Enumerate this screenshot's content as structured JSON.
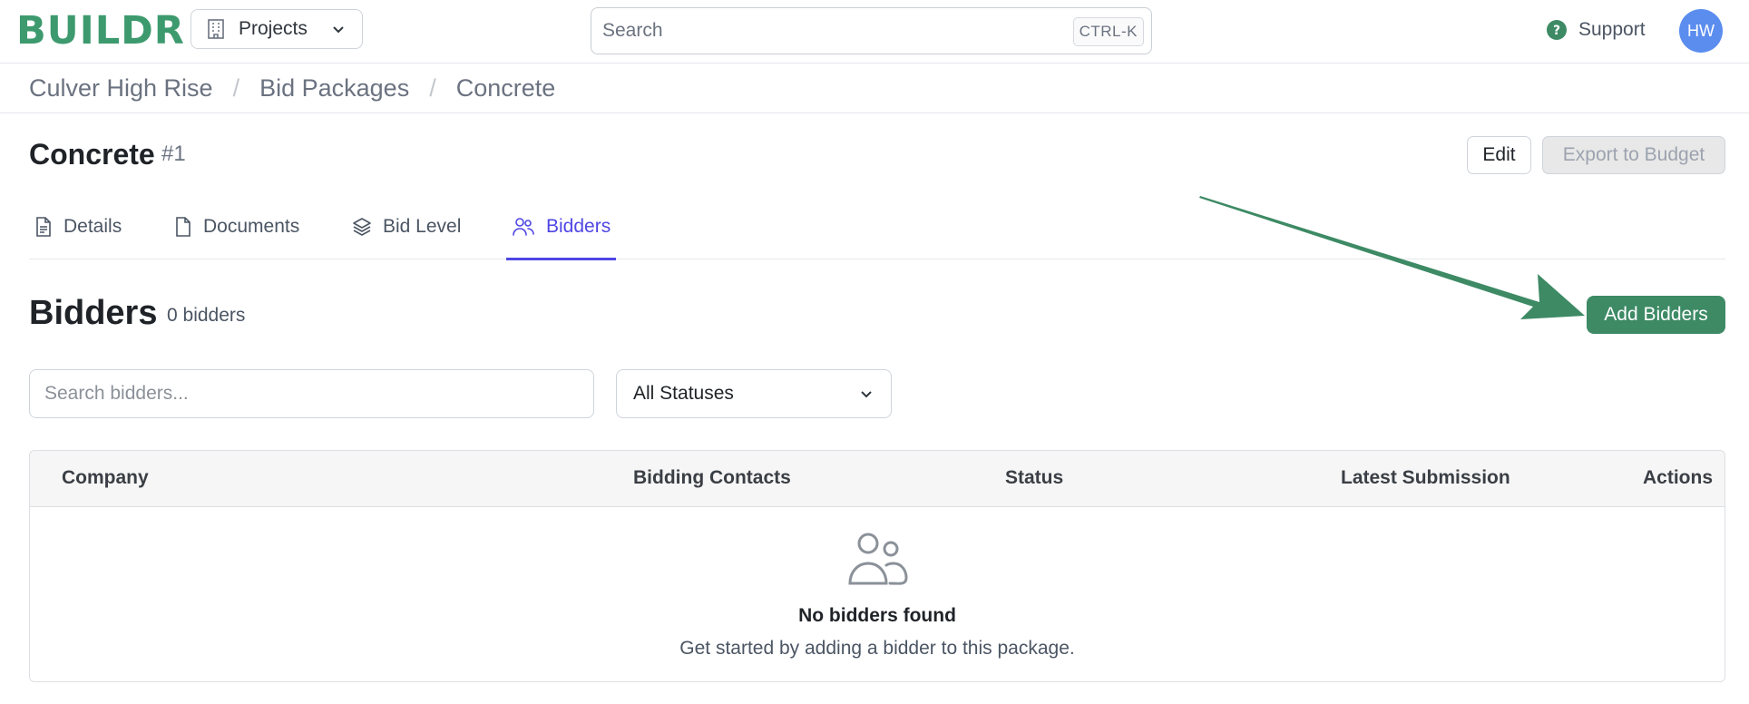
{
  "app": {
    "logo": "BUILDR"
  },
  "topbar": {
    "projects_label": "Projects",
    "search_placeholder": "Search",
    "search_shortcut": "CTRL-K",
    "support_label": "Support",
    "avatar_initials": "HW"
  },
  "breadcrumb": [
    "Culver High Rise",
    "Bid Packages",
    "Concrete"
  ],
  "page": {
    "title": "Concrete",
    "number": "#1",
    "edit_label": "Edit",
    "export_label": "Export to Budget"
  },
  "tabs": [
    {
      "label": "Details",
      "icon": "document-text-icon",
      "active": false
    },
    {
      "label": "Documents",
      "icon": "document-icon",
      "active": false
    },
    {
      "label": "Bid Level",
      "icon": "layers-icon",
      "active": false
    },
    {
      "label": "Bidders",
      "icon": "users-icon",
      "active": true
    }
  ],
  "bidders": {
    "title": "Bidders",
    "count": "0 bidders",
    "add_label": "Add Bidders",
    "search_placeholder": "Search bidders...",
    "status_filter": "All Statuses",
    "columns": [
      "Company",
      "Bidding Contacts",
      "Status",
      "Latest Submission",
      "Actions"
    ],
    "empty_title": "No bidders found",
    "empty_subtitle": "Get started by adding a bidder to this package."
  },
  "colors": {
    "brand": "#3d9a6e",
    "primary_button": "#3d8a65",
    "active_tab": "#4f46e5",
    "avatar": "#5b8def",
    "annotation_arrow": "#3d8a65"
  }
}
